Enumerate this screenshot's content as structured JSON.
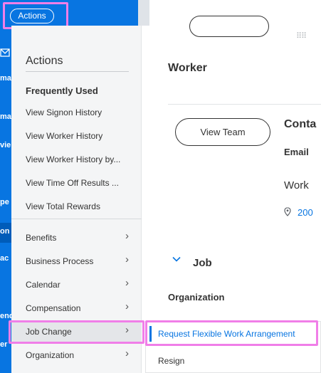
{
  "header": {
    "actions_label": "Actions"
  },
  "app_strip": {
    "fragments": [
      "ma",
      "ma",
      "vie",
      "pe",
      "on",
      "ac",
      "end",
      "er"
    ]
  },
  "menu": {
    "title": "Actions",
    "section_title": "Frequently Used",
    "frequent": [
      "View Signon History",
      "View Worker History",
      "View Worker History by...",
      "View Time Off Results ...",
      "View Total Rewards"
    ],
    "categories": [
      "Benefits",
      "Business Process",
      "Calendar",
      "Compensation",
      "Job Change",
      "Organization"
    ],
    "active_category": "Job Change"
  },
  "submenu": {
    "items": [
      "Request Flexible Work Arrangement",
      "Resign"
    ]
  },
  "worker_panel": {
    "title": "Worker",
    "view_team_label": "View Team",
    "contact_heading": "Conta",
    "email_label": "Email",
    "work_label": "Work",
    "address_snippet": "200",
    "job_section": "Job",
    "organization_label": "Organization"
  },
  "icons": {
    "chevron": "chevron-right-icon",
    "location": "map-pin-icon",
    "grip": "drag-grip-icon",
    "expand": "chevron-down-icon"
  },
  "colors": {
    "brand_blue": "#0875e1",
    "highlight_pink": "#f07ee8",
    "menu_bg": "#f4f5f6"
  }
}
